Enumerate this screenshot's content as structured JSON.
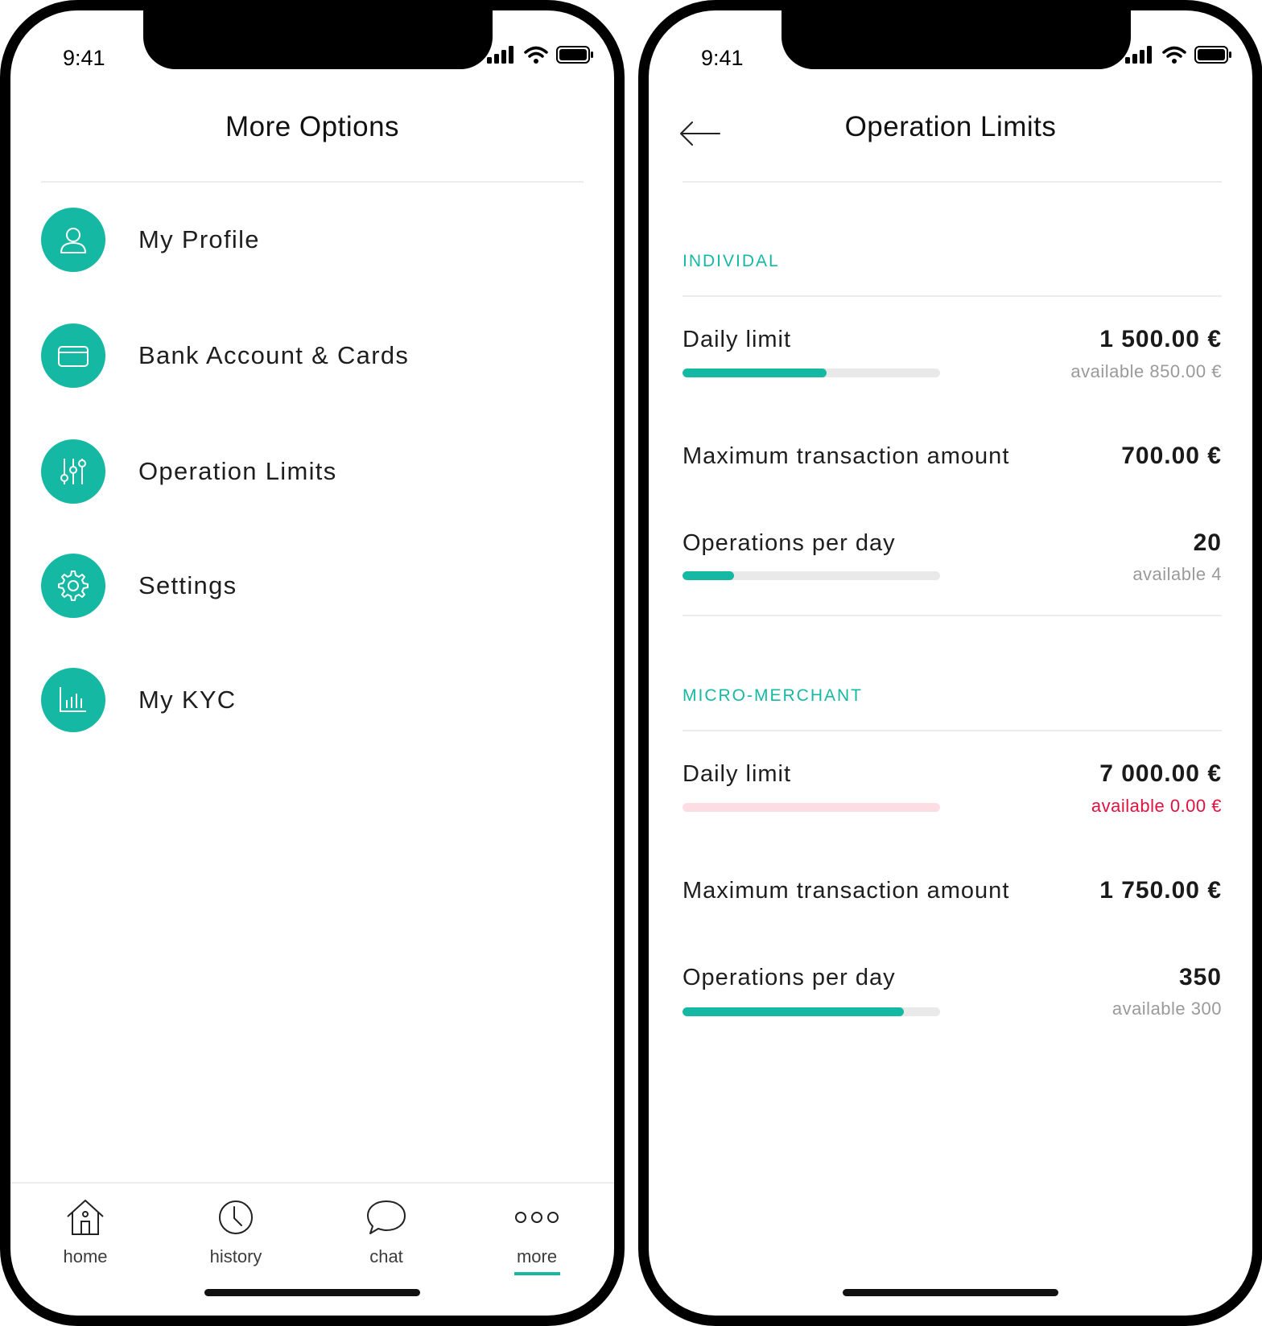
{
  "colors": {
    "accent": "#15b8a3",
    "warning": "#e0123f",
    "warning_track": "#fcdde3"
  },
  "status_bar": {
    "time": "9:41"
  },
  "left": {
    "title": "More Options",
    "menu": [
      {
        "label": "My Profile",
        "icon": "user-icon"
      },
      {
        "label": "Bank Account & Cards",
        "icon": "card-icon"
      },
      {
        "label": "Operation Limits",
        "icon": "sliders-icon"
      },
      {
        "label": "Settings",
        "icon": "gear-icon"
      },
      {
        "label": "My KYC",
        "icon": "bar-chart-icon"
      }
    ],
    "nav": [
      {
        "label": "home",
        "icon": "home-icon"
      },
      {
        "label": "history",
        "icon": "clock-icon"
      },
      {
        "label": "chat",
        "icon": "chat-bubble-icon"
      },
      {
        "label": "more",
        "icon": "more-dots-icon",
        "active": true
      }
    ]
  },
  "right": {
    "title": "Operation Limits",
    "sections": [
      {
        "title": "INDIVIDAL",
        "rows": [
          {
            "label": "Daily limit",
            "value": "1 500.00 €",
            "available": "available  850.00 €",
            "progress": 0.56
          },
          {
            "label": "Maximum transaction amount",
            "value": "700.00 €"
          },
          {
            "label": "Operations per day",
            "value": "20",
            "available": "available  4",
            "progress": 0.2
          }
        ]
      },
      {
        "title": "MICRO-MERCHANT",
        "rows": [
          {
            "label": "Daily limit",
            "value": "7 000.00 €",
            "available": "available  0.00 €",
            "progress": 1.0,
            "exhausted": true
          },
          {
            "label": "Maximum transaction amount",
            "value": "1 750.00 €"
          },
          {
            "label": "Operations per day",
            "value": "350",
            "available": "available  300",
            "progress": 0.86
          }
        ]
      }
    ]
  }
}
